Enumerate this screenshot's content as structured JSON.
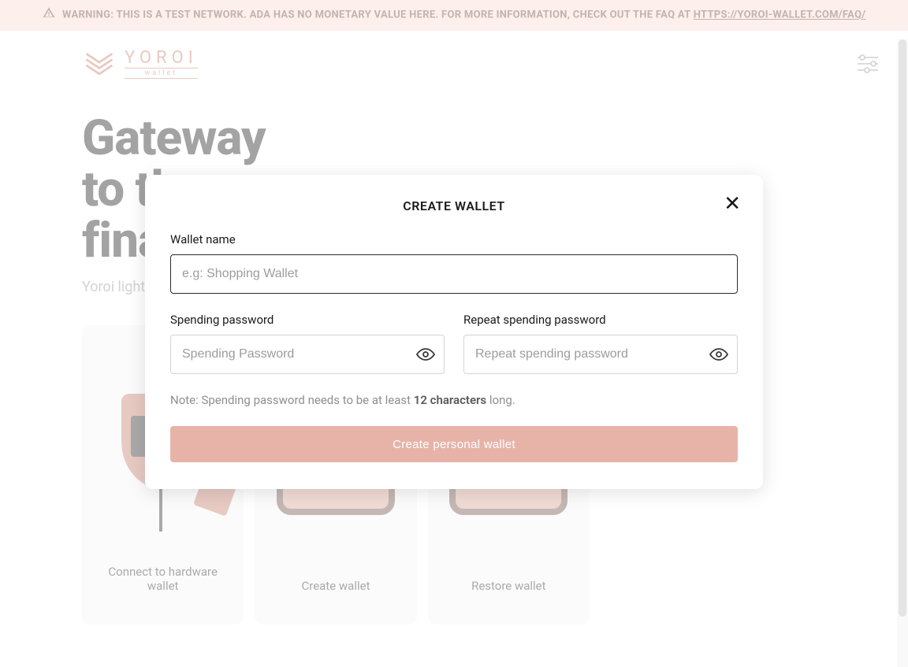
{
  "banner": {
    "text_prefix": "WARNING: THIS IS A TEST NETWORK. ADA HAS NO MONETARY VALUE HERE. FOR MORE INFORMATION, CHECK OUT THE FAQ AT ",
    "link_text": "HTTPS://YOROI-WALLET.COM/FAQ/"
  },
  "logo": {
    "brand": "YOROI",
    "sub": "wallet"
  },
  "hero": {
    "title_line1": "Gateway",
    "title_line2": "to the",
    "title_line3": "financial",
    "subtitle": "Yoroi light wallet for Cardano assets"
  },
  "cards": [
    {
      "label": "Connect to hardware wallet"
    },
    {
      "label": "Create wallet"
    },
    {
      "label": "Restore wallet"
    }
  ],
  "modal": {
    "title": "CREATE WALLET",
    "wallet_name_label": "Wallet name",
    "wallet_name_placeholder": "e.g: Shopping Wallet",
    "spending_label": "Spending password",
    "spending_placeholder": "Spending Password",
    "repeat_label": "Repeat spending password",
    "repeat_placeholder": "Repeat spending password",
    "note_prefix": "Note: Spending password needs to be at least ",
    "note_bold": "12 characters",
    "note_suffix": " long.",
    "button": "Create personal wallet"
  },
  "colors": {
    "accent": "#c47b66",
    "button_bg": "#e7b3a9",
    "banner_bg": "#f8d7d0"
  }
}
